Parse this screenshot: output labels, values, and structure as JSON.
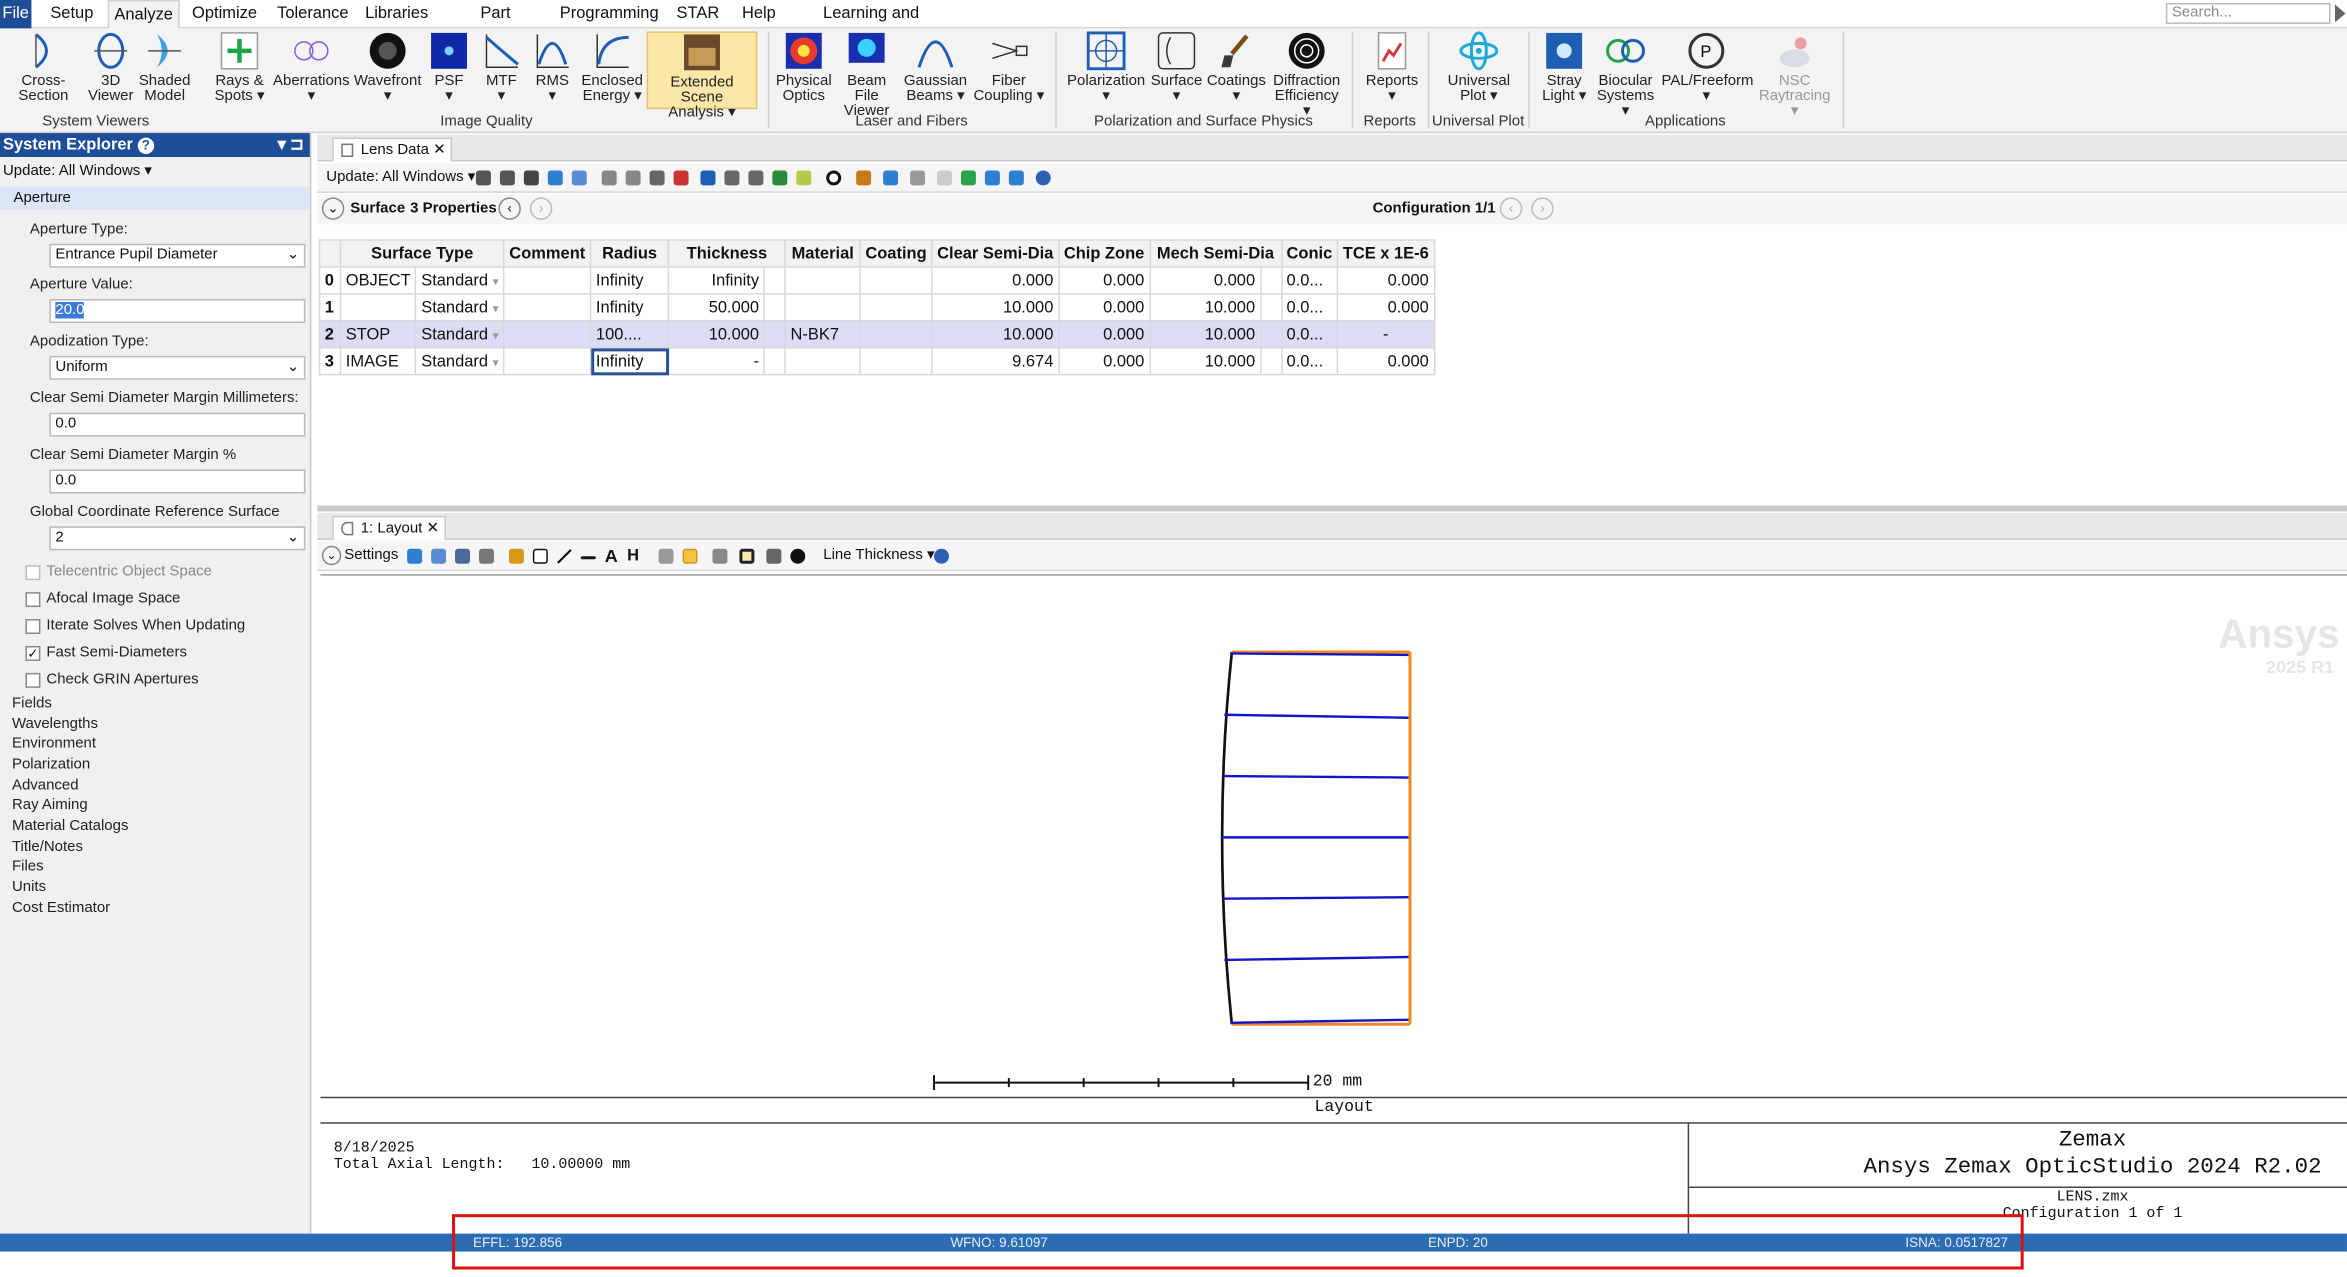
{
  "menu": {
    "file": "File",
    "tabs": [
      "Setup",
      "Analyze",
      "Optimize",
      "Tolerance",
      "Libraries",
      "Part Designer",
      "Programming",
      "STAR",
      "Help",
      "Learning and Support"
    ],
    "search_placeholder": "Search..."
  },
  "ribbon": {
    "buttons": [
      [
        "Cross-Section",
        ""
      ],
      [
        "3D",
        "Viewer"
      ],
      [
        "Shaded",
        "Model"
      ],
      [
        "Rays &",
        "Spots ▾"
      ],
      [
        "Aberrations",
        "▾"
      ],
      [
        "Wavefront",
        "▾"
      ],
      [
        "PSF",
        "▾"
      ],
      [
        "MTF",
        "▾"
      ],
      [
        "RMS",
        "▾"
      ],
      [
        "Enclosed",
        "Energy ▾"
      ],
      [
        "Extended Scene",
        "Analysis ▾"
      ],
      [
        "Physical",
        "Optics"
      ],
      [
        "Beam File",
        "Viewer"
      ],
      [
        "Gaussian",
        "Beams ▾"
      ],
      [
        "Fiber",
        "Coupling ▾"
      ],
      [
        "Polarization",
        "▾"
      ],
      [
        "Surface",
        "▾"
      ],
      [
        "Coatings",
        "▾"
      ],
      [
        "Diffraction",
        "Efficiency ▾"
      ],
      [
        "Reports",
        "▾"
      ],
      [
        "Universal",
        "Plot ▾"
      ],
      [
        "Stray",
        "Light ▾"
      ],
      [
        "Biocular",
        "Systems ▾"
      ],
      [
        "PAL/Freeform",
        "▾"
      ],
      [
        "NSC",
        "Raytracing ▾"
      ]
    ],
    "groups": [
      "System Viewers",
      "Image Quality",
      "Laser and Fibers",
      "Polarization and Surface Physics",
      "Reports",
      "Universal Plot",
      "Applications"
    ]
  },
  "system_explorer": {
    "title": "System Explorer",
    "update": "Update: All Windows ▾",
    "section": "Aperture",
    "aperture_type_label": "Aperture Type:",
    "aperture_type": "Entrance Pupil Diameter",
    "aperture_value_label": "Aperture Value:",
    "aperture_value": "20.0",
    "apodization_label": "Apodization Type:",
    "apodization": "Uniform",
    "csd_mm_label": "Clear Semi Diameter Margin Millimeters:",
    "csd_mm": "0.0",
    "csd_pct_label": "Clear Semi Diameter Margin %",
    "csd_pct": "0.0",
    "gcrs_label": "Global Coordinate Reference Surface",
    "gcrs": "2",
    "checks": [
      {
        "label": "Telecentric Object Space",
        "checked": false,
        "disabled": true
      },
      {
        "label": "Afocal Image Space",
        "checked": false
      },
      {
        "label": "Iterate Solves When Updating",
        "checked": false
      },
      {
        "label": "Fast Semi-Diameters",
        "checked": true
      },
      {
        "label": "Check GRIN Apertures",
        "checked": false
      }
    ],
    "tree": [
      "Fields",
      "Wavelengths",
      "Environment",
      "Polarization",
      "Advanced",
      "Ray Aiming",
      "Material Catalogs",
      "Title/Notes",
      "Files",
      "Units",
      "Cost Estimator"
    ]
  },
  "lens_data": {
    "tab": "Lens Data",
    "update": "Update: All Windows ▾",
    "surface_label": "Surface",
    "properties": "3 Properties",
    "configuration": "Configuration 1/1",
    "headers": [
      "",
      "Surface Type",
      "Comment",
      "Radius",
      "Thickness",
      "Material",
      "Coating",
      "Clear Semi-Dia",
      "Chip Zone",
      "Mech Semi-Dia",
      "Conic",
      "TCE x 1E-6"
    ],
    "rows": [
      [
        "0",
        "OBJECT",
        "Standard",
        "",
        "Infinity",
        "Infinity",
        "",
        "",
        "0.000",
        "0.000",
        "0.000",
        "0.0...",
        "0.000"
      ],
      [
        "1",
        "",
        "Standard",
        "",
        "Infinity",
        "50.000",
        "",
        "",
        "10.000",
        "0.000",
        "10.000",
        "0.0...",
        "0.000"
      ],
      [
        "2",
        "STOP",
        "Standard",
        "",
        "100....",
        "10.000",
        "N-BK7",
        "",
        "10.000",
        "0.000",
        "10.000",
        "0.0...",
        "-"
      ],
      [
        "3",
        "IMAGE",
        "Standard",
        "",
        "Infinity",
        "-",
        "",
        "",
        "9.674",
        "0.000",
        "10.000",
        "0.0...",
        "0.000"
      ]
    ]
  },
  "layout": {
    "tab": "1: Layout",
    "settings": "Settings",
    "line_thickness": "Line Thickness ▾",
    "scale": "20 mm",
    "title": "Layout",
    "date": "8/18/2025",
    "axial": "Total Axial Length:   10.00000 mm",
    "brand1": "Zemax",
    "brand2": "Ansys Zemax OpticStudio 2024 R2.02",
    "file": "LENS.zmx",
    "config": "Configuration 1 of 1",
    "watermark1": "Ansys",
    "watermark2": "2025 R1"
  },
  "status": {
    "effl": "EFFL: 192.856",
    "wfno": "WFNO: 9.61097",
    "enpd": "ENPD: 20",
    "isna": "ISNA: 0.0517827"
  }
}
